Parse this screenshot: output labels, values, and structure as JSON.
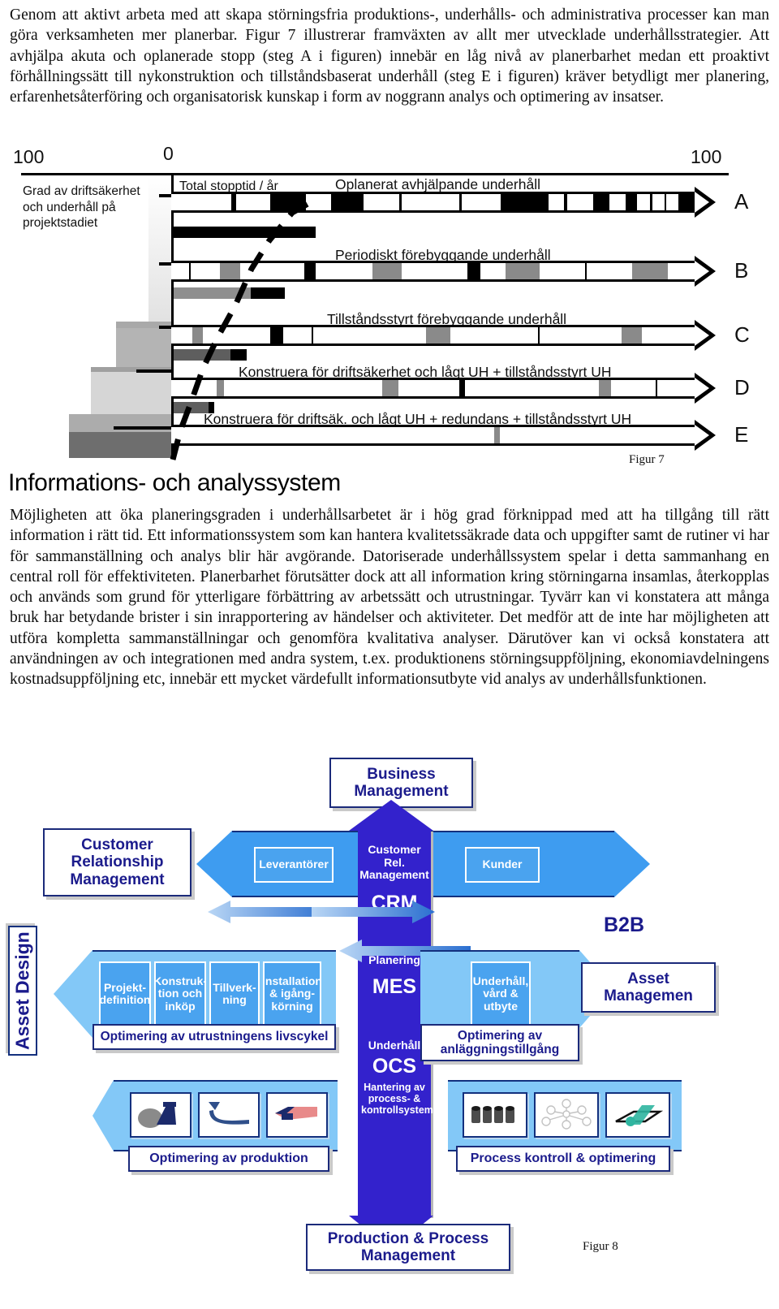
{
  "intro_paragraph": "Genom att aktivt arbeta med att skapa störningsfria produktions-, underhålls- och administrativa processer kan man göra verksamheten mer planerbar. Figur 7 illustrerar framväxten av allt mer utvecklade underhållsstrategier. Att avhjälpa akuta och oplanerade stopp (steg A i figuren) innebär en låg nivå av planerbarhet medan ett proaktivt förhållningssätt till nykonstruktion och tillståndsbaserat underhåll (steg E i figuren) kräver betydligt mer planering, erfarenhetsåterföring och organisatorisk kunskap i form av noggrann analys och optimering av insatser.",
  "section_heading": "Informations- och analyssystem",
  "body_paragraph": "Möjligheten att öka planeringsgraden i underhållsarbetet är i hög grad förknippad med att ha tillgång till rätt information i rätt tid. Ett informationssystem som kan hantera kvalitetssäkrade data och uppgifter samt de rutiner vi har för sammanställning och analys blir här avgörande. Datoriserade underhållssystem spelar i detta sammanhang en central roll för effektiviteten. Planerbarhet förutsätter dock att all information kring störningarna insamlas, återkopplas och används som grund för ytterligare förbättring av arbetssätt och utrustningar. Tyvärr kan vi konstatera att många bruk har betydande brister i sin inrapportering av händelser och aktiviteter. Det medför att de inte har möjligheten att utföra kompletta sammanställningar och genomföra kvalitativa analyser. Därutöver kan vi också konstatera att användningen av och integrationen med andra system, t.ex. produktionens störningsuppföljning, ekonomiavdelningens kostnadsuppföljning etc, innebär ett mycket värdefullt informationsutbyte vid analys av underhållsfunktionen.",
  "figure7": {
    "caption": "Figur 7",
    "axis_left_label": "100",
    "axis_zero_label": "0",
    "axis_right_label": "100",
    "side_label": "Grad av driftsäkerhet och underhåll på projektstadiet",
    "total_stop_label": "Total stopptid / år",
    "rows": [
      {
        "letter": "A",
        "title": "Oplanerat avhjälpande underhåll"
      },
      {
        "letter": "B",
        "title": "Periodiskt förebyggande underhåll"
      },
      {
        "letter": "C",
        "title": "Tillståndsstyrt förebyggande underhåll"
      },
      {
        "letter": "D",
        "title": "Konstruera för driftsäkerhet och lågt UH + tillståndsstyrt UH"
      },
      {
        "letter": "E",
        "title": "Konstruera för driftsäk. och lågt UH + redundans + tillståndsstyrt UH"
      }
    ]
  },
  "figure8": {
    "caption": "Figur 8",
    "business_management": "Business\nManagement",
    "customer_relationship_management": "Customer\nRelationship\nManagement",
    "asset_design": "Asset Design",
    "b2b": "B2B",
    "asset_management": "Asset\nManagemen",
    "production_process_management": "Production & Process\nManagement",
    "suppliers_box": "Leverantörer",
    "customers_box": "Kunder",
    "crm_column": {
      "small": "Customer\nRel.\nManagement",
      "big": "CRM"
    },
    "mes_column": {
      "small": "Planering",
      "big": "MES"
    },
    "ocs_column": {
      "small": "Underhåll",
      "big": "OCS",
      "tiny": "Hantering av process- & kontrollsystem"
    },
    "lifecycle_stages": [
      "Projekt-definition",
      "Konstruk-tion och inköp",
      "Tillverk-ning",
      "Installation & igång-körning"
    ],
    "maintenance_stage": "Underhåll, vård & utbyte",
    "optimize_lifecycle": "Optimering av utrustningens livscykel",
    "optimize_asset": "Optimering av anläggningstillgång",
    "optimize_production": "Optimering av produktion",
    "process_control": "Process kontroll & optimering"
  },
  "colors": {
    "brand_dark_blue": "#1b1b8c",
    "brand_blue": "#3322cc",
    "accent_blue": "#3e9cf0",
    "light_blue": "#83c8f7",
    "border_blue": "#13307e"
  }
}
